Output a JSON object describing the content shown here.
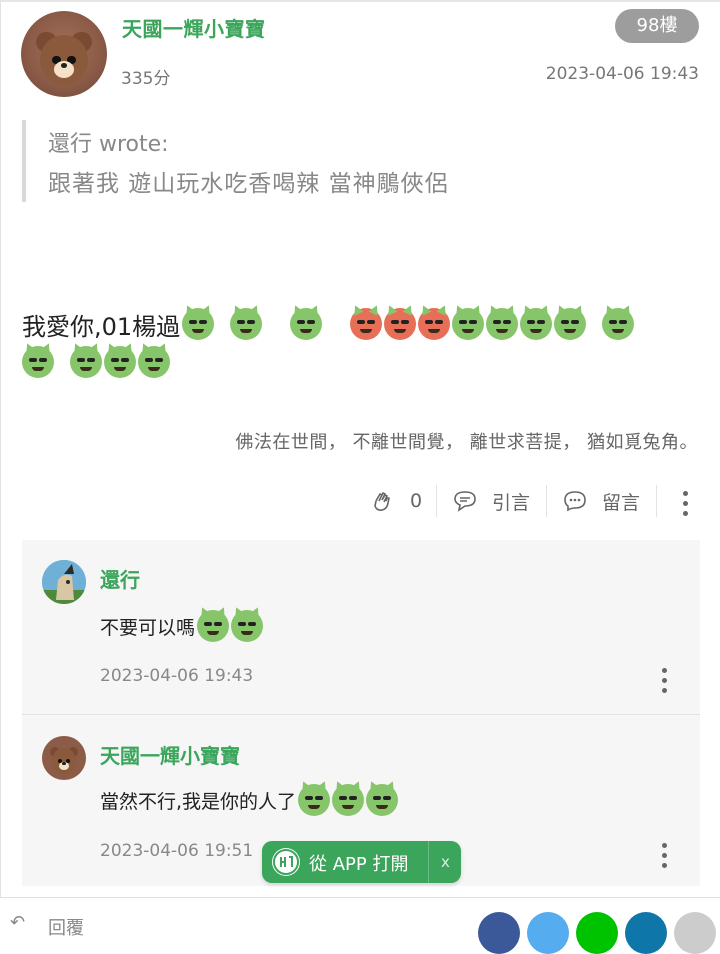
{
  "post": {
    "author": "天國一輝小寶寶",
    "score": "335分",
    "floor": "98樓",
    "date": "2023-04-06 19:43",
    "quote": {
      "header": "還行 wrote:",
      "text": "跟著我 遊山玩水吃香喝辣 當神鵰俠侶"
    },
    "message": "我愛你,01楊過",
    "signature": "佛法在世間， 不離世間覺， 離世求菩提， 猶如覓兔角。"
  },
  "actions": {
    "like_count": "0",
    "quote_label": "引言",
    "comment_label": "留言"
  },
  "replies": [
    {
      "name": "還行",
      "text": "不要可以嗎",
      "date": "2023-04-06 19:43"
    },
    {
      "name": "天國一輝小寶寶",
      "text": "當然不行,我是你的人了",
      "date": "2023-04-06 19:51"
    }
  ],
  "app_button": {
    "label": "從 APP 打開",
    "close": "x"
  },
  "bottom_bar": {
    "reply_label": "回覆"
  },
  "icons": {
    "clap": "clap-icon",
    "quote": "quote-bubble-icon",
    "comment": "comment-bubble-icon",
    "more": "more-vertical-icon",
    "reply": "reply-arrow-icon"
  },
  "colors": {
    "accent": "#3aa55b",
    "floor_badge": "#9d9d9d",
    "reply_bg": "#f6f6f6",
    "facebook": "#3b5998",
    "twitter": "#55acee",
    "line": "#00c300",
    "linkedin": "#0e76a8",
    "other": "#cccccc"
  }
}
